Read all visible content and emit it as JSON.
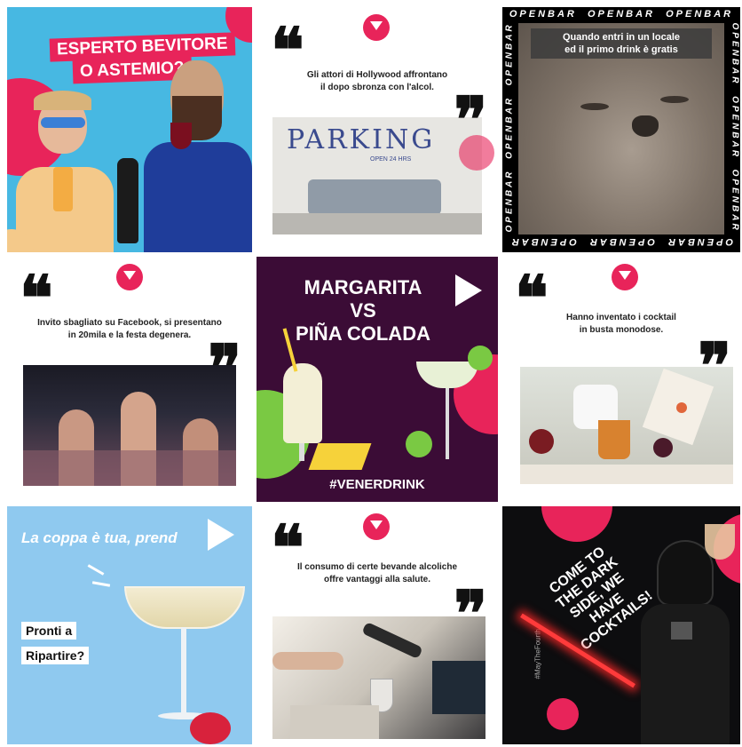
{
  "tiles": {
    "t1": {
      "title_line1": "ESPERTO BEVITORE",
      "title_line2": "O ASTEMIO?"
    },
    "t2": {
      "caption_line1": "Gli attori di Hollywood affrontano",
      "caption_line2": "il dopo sbronza con l'alcol.",
      "sign": "PARKING",
      "sign_sub": "OPEN 24 HRS"
    },
    "t3": {
      "brand": "OPENBAR",
      "caption_line1": "Quando entri in un locale",
      "caption_line2": "ed il primo drink è gratis"
    },
    "t4": {
      "caption_line1": "Invito sbagliato su Facebook, si presentano",
      "caption_line2": "in 20mila e la festa degenera."
    },
    "t5": {
      "title_line1": "MARGARITA",
      "title_line2": "VS",
      "title_line3": "PIÑA COLADA",
      "hashtag": "#VENERDRINK"
    },
    "t6": {
      "caption_line1": "Hanno inventato i cocktail",
      "caption_line2": "in busta monodose."
    },
    "t7": {
      "headline": "La coppa è tua, prend",
      "badge_line1": "Pronti a",
      "badge_line2": "Ripartire?"
    },
    "t8": {
      "caption_line1": "Il consumo di certe bevande alcoliche",
      "caption_line2": "offre vantaggi alla salute."
    },
    "t9": {
      "text": "COME TO THE DARK SIDE, WE HAVE COCKTAILS!",
      "hashtag": "#MayTheFourth"
    }
  },
  "colors": {
    "brand_pink": "#e8245a",
    "purple": "#3b0c36",
    "sky": "#47b8e2",
    "lime": "#7ac943"
  },
  "icons": [
    "quote-open-icon",
    "quote-close-icon",
    "cocktail-logo-icon",
    "play-icon"
  ]
}
